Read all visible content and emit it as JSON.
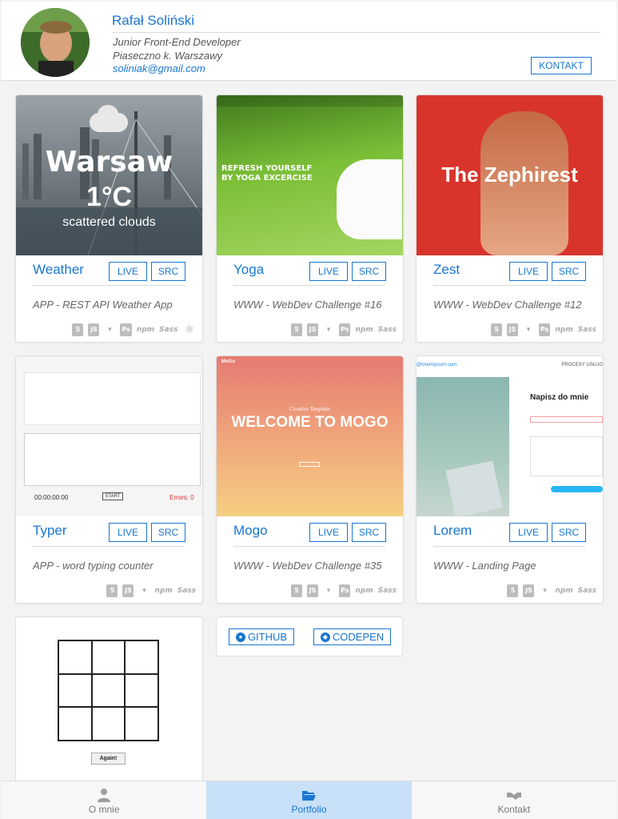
{
  "profile": {
    "name": "Rafał Soliński",
    "job": "Junior Front-End Developer",
    "location": "Piaseczno k. Warszawy",
    "email": "soliniak@gmail.com",
    "contact_button": "KONTAKT"
  },
  "buttons": {
    "live": "LIVE",
    "src": "SRC"
  },
  "projects": [
    {
      "title": "Weather",
      "description": "APP - REST API Weather App",
      "thumb": {
        "city": "Warsaw",
        "temp": "1°C",
        "sky": "scattered clouds"
      },
      "techs": [
        "html5-icon",
        "js-icon",
        "gulp-icon",
        "ps-icon",
        "npm-icon",
        "sass-icon",
        "react-icon"
      ]
    },
    {
      "title": "Yoga",
      "description": "WWW - WebDev Challenge #16",
      "thumb": {
        "headline": "REFRESH YOURSELF BY YOGA EXCERCISE"
      },
      "techs": [
        "html5-icon",
        "js-icon",
        "gulp-icon",
        "ps-icon",
        "npm-icon",
        "sass-icon"
      ]
    },
    {
      "title": "Zest",
      "description": "WWW - WebDev Challenge #12",
      "thumb": {
        "headline": "The Zephirest"
      },
      "techs": [
        "html5-icon",
        "js-icon",
        "gulp-icon",
        "ps-icon",
        "npm-icon",
        "sass-icon"
      ]
    },
    {
      "title": "Typer",
      "description": "APP - word typing counter",
      "thumb": {
        "timer": "00:00:00:00",
        "start": "START",
        "errors": "Errors: 0"
      },
      "techs": [
        "html5-icon",
        "js-icon",
        "gulp-icon",
        "npm-icon",
        "sass-icon"
      ]
    },
    {
      "title": "Mogo",
      "description": "WWW - WebDev Challenge #35",
      "thumb": {
        "logo": "MoGo",
        "sub": "Creative Template",
        "headline": "WELCOME TO MOGO"
      },
      "techs": [
        "html5-icon",
        "js-icon",
        "gulp-icon",
        "ps-icon",
        "npm-icon",
        "sass-icon"
      ]
    },
    {
      "title": "Lorem",
      "description": "WWW - Landing Page",
      "thumb": {
        "url": "@loremipsum.com",
        "nav": "PROCESY  USŁUG",
        "headline": "Napisz do mnie"
      },
      "techs": [
        "html5-icon",
        "js-icon",
        "gulp-icon",
        "npm-icon",
        "sass-icon"
      ]
    }
  ],
  "tictactoe": {
    "again_button": "Again!"
  },
  "links": {
    "github": "GITHUB",
    "codepen": "CODEPEN"
  },
  "nav": {
    "items": [
      {
        "label": "O mnie",
        "icon": "user-icon",
        "active": false
      },
      {
        "label": "Portfolio",
        "icon": "folder-open-icon",
        "active": true
      },
      {
        "label": "Kontakt",
        "icon": "handshake-icon",
        "active": false
      }
    ]
  },
  "colors": {
    "accent": "#1976d2",
    "active_nav": "#c8e0f8"
  }
}
